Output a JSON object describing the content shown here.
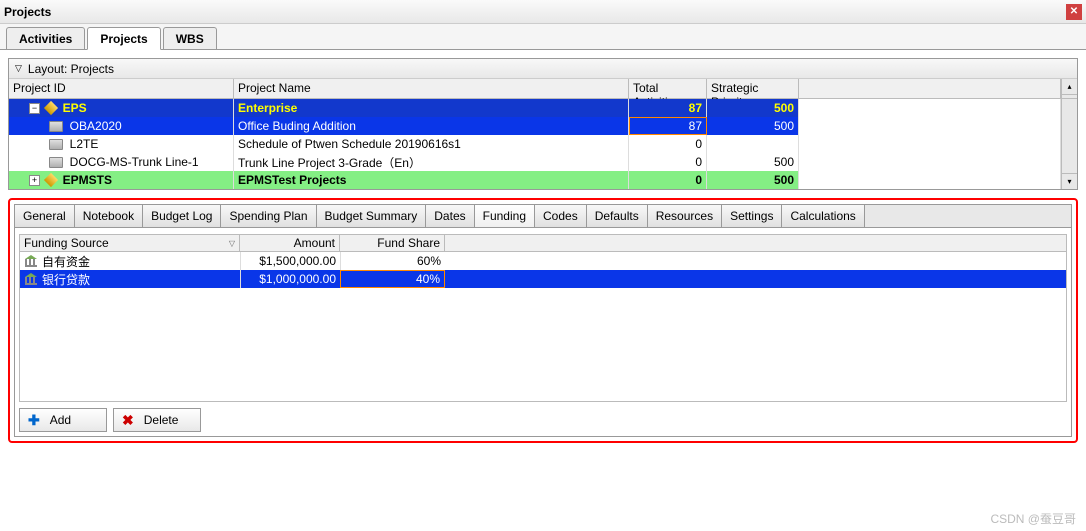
{
  "window": {
    "title": "Projects"
  },
  "main_tabs": {
    "activities": "Activities",
    "projects": "Projects",
    "wbs": "WBS",
    "active": "projects"
  },
  "layout_bar": {
    "label": "Layout: Projects"
  },
  "grid": {
    "headers": {
      "project_id": "Project ID",
      "project_name": "Project Name",
      "total_activities": "Total Activities",
      "strategic_priority": "Strategic Priority"
    },
    "rows": [
      {
        "type": "eps",
        "id": "EPS",
        "name": "Enterprise",
        "ta": "87",
        "sp": "500",
        "expanded": true
      },
      {
        "type": "selected",
        "id": "OBA2020",
        "name": "Office Buding Addition",
        "ta": "87",
        "sp": "500"
      },
      {
        "type": "normal",
        "id": "L2TE",
        "name": "Schedule of Ptwen Schedule 20190616s1",
        "ta": "0",
        "sp": ""
      },
      {
        "type": "normal",
        "id": "DOCG-MS-Trunk Line-1",
        "name": "Trunk Line Project 3-Grade（En）",
        "ta": "0",
        "sp": "500"
      },
      {
        "type": "green",
        "id": "EPMSTS",
        "name": "EPMSTest Projects",
        "ta": "0",
        "sp": "500",
        "expanded": false
      }
    ]
  },
  "detail_tabs": [
    "General",
    "Notebook",
    "Budget Log",
    "Spending Plan",
    "Budget Summary",
    "Dates",
    "Funding",
    "Codes",
    "Defaults",
    "Resources",
    "Settings",
    "Calculations"
  ],
  "detail_active": "Funding",
  "funding": {
    "headers": {
      "source": "Funding Source",
      "amount": "Amount",
      "share": "Fund Share"
    },
    "rows": [
      {
        "source": "自有资金",
        "amount": "$1,500,000.00",
        "share": "60%",
        "selected": false
      },
      {
        "source": "银行贷款",
        "amount": "$1,000,000.00",
        "share": "40%",
        "selected": true
      }
    ]
  },
  "buttons": {
    "add": "Add",
    "delete": "Delete"
  },
  "watermark": "CSDN @蚕豆哥"
}
